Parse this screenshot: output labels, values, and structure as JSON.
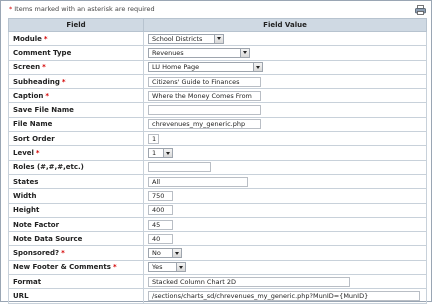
{
  "note": {
    "star": "*",
    "text": "Items marked with an asterisk are required"
  },
  "table": {
    "col_field": "Field",
    "col_value": "Field Value"
  },
  "rows": [
    {
      "label": "Module",
      "required": true,
      "type": "select",
      "value": "School Districts"
    },
    {
      "label": "Comment Type",
      "required": false,
      "type": "select",
      "value": "Revenues"
    },
    {
      "label": "Screen",
      "required": true,
      "type": "select",
      "value": "LU Home Page"
    },
    {
      "label": "Subheading",
      "required": true,
      "type": "text",
      "value": "Citizens' Guide to Finances"
    },
    {
      "label": "Caption",
      "required": true,
      "type": "text",
      "value": "Where the Money Comes From"
    },
    {
      "label": "Save File Name",
      "required": false,
      "type": "text",
      "value": ""
    },
    {
      "label": "File Name",
      "required": false,
      "type": "text",
      "value": "chrevenues_my_generic.php"
    },
    {
      "label": "Sort Order",
      "required": false,
      "type": "text",
      "value": "1"
    },
    {
      "label": "Level",
      "required": true,
      "type": "select",
      "value": "1"
    },
    {
      "label": "Roles (#,#,#,etc.)",
      "required": false,
      "type": "text",
      "value": ""
    },
    {
      "label": "States",
      "required": false,
      "type": "text",
      "value": "All"
    },
    {
      "label": "Width",
      "required": false,
      "type": "text",
      "value": "750"
    },
    {
      "label": "Height",
      "required": false,
      "type": "text",
      "value": "400"
    },
    {
      "label": "Note Factor",
      "required": false,
      "type": "text",
      "value": "45"
    },
    {
      "label": "Note Data Source",
      "required": false,
      "type": "text",
      "value": "40"
    },
    {
      "label": "Sponsored?",
      "required": true,
      "type": "select",
      "value": "No"
    },
    {
      "label": "New Footer & Comments",
      "required": true,
      "type": "select",
      "value": "Yes"
    },
    {
      "label": "Format",
      "required": false,
      "type": "text",
      "value": "Stacked Column Chart 2D"
    },
    {
      "label": "URL",
      "required": false,
      "type": "text",
      "value": "/sections/charts_sd/chrevenues_my_generic.php?MunID={MunID}"
    }
  ]
}
